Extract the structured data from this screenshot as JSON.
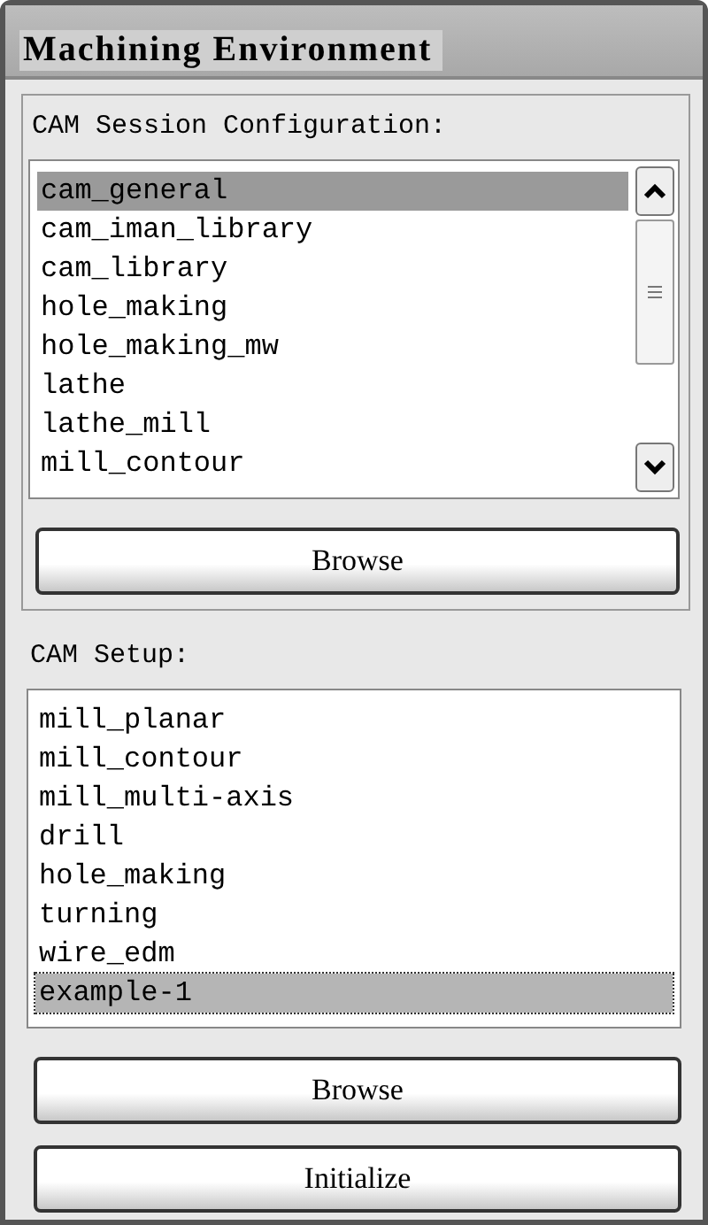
{
  "window": {
    "title": "Machining Environment"
  },
  "session_configuration": {
    "label": "CAM Session Configuration:",
    "items": [
      {
        "text": "cam_general",
        "selected": true
      },
      {
        "text": "cam_iman_library",
        "selected": false
      },
      {
        "text": "cam_library",
        "selected": false
      },
      {
        "text": "hole_making",
        "selected": false
      },
      {
        "text": "hole_making_mw",
        "selected": false
      },
      {
        "text": "lathe",
        "selected": false
      },
      {
        "text": "lathe_mill",
        "selected": false
      },
      {
        "text": "mill_contour",
        "selected": false
      }
    ],
    "button": "Browse"
  },
  "setup": {
    "label": "CAM Setup:",
    "items": [
      {
        "text": "mill_planar",
        "selected": false
      },
      {
        "text": "mill_contour",
        "selected": false
      },
      {
        "text": "mill_multi-axis",
        "selected": false
      },
      {
        "text": "drill",
        "selected": false
      },
      {
        "text": "hole_making",
        "selected": false
      },
      {
        "text": "turning",
        "selected": false
      },
      {
        "text": "wire_edm",
        "selected": false
      },
      {
        "text": "example-1",
        "selected": true
      }
    ],
    "buttons": [
      "Browse",
      "Initialize"
    ]
  }
}
